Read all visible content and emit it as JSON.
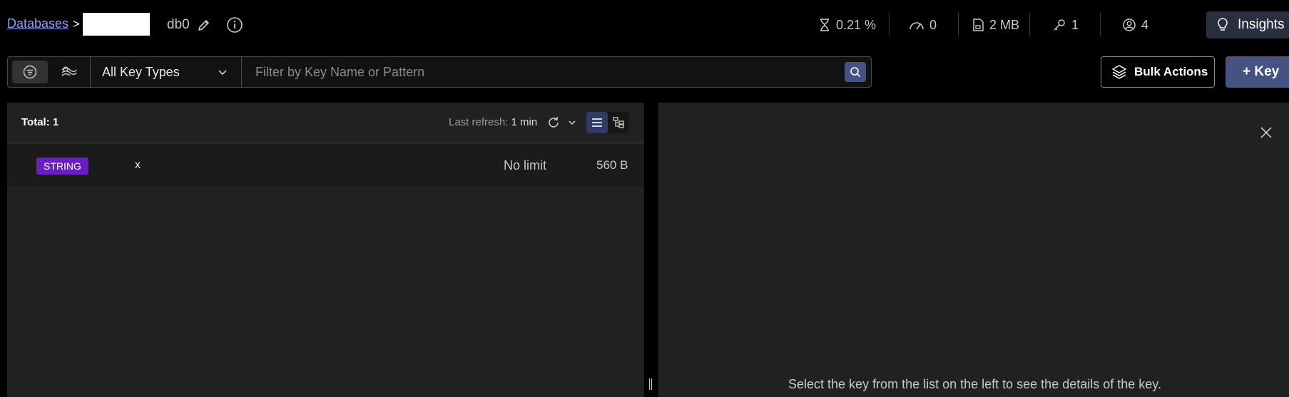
{
  "breadcrumb": {
    "databases_label": "Databases",
    "separator": ">",
    "db_name": "db0"
  },
  "stats": {
    "cpu": "0.21 %",
    "ops": "0",
    "memory": "2 MB",
    "keys": "1",
    "clients": "4"
  },
  "insights_label": "Insights",
  "filter": {
    "key_type": "All Key Types",
    "search_placeholder": "Filter by Key Name or Pattern"
  },
  "actions": {
    "bulk_label": "Bulk Actions",
    "add_key_label": "+ Key"
  },
  "key_list": {
    "total": "Total: 1",
    "last_refresh_label": "Last refresh: ",
    "last_refresh_value": "1 min",
    "rows": [
      {
        "type": "STRING",
        "name": "x",
        "ttl": "No limit",
        "size": "560 B"
      }
    ]
  },
  "details": {
    "empty_message": "Select the key from the list on the left to see the details of the key."
  },
  "colors": {
    "accent": "#465282",
    "string_badge": "#6a1dc3",
    "link": "#8ba2ff"
  }
}
